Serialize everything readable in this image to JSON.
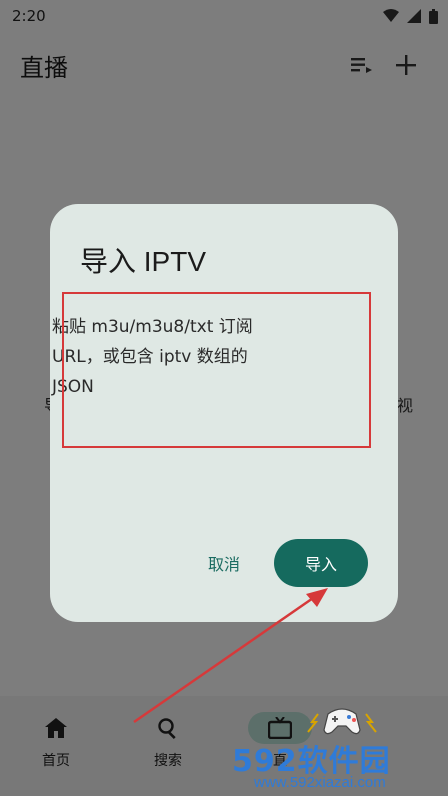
{
  "status": {
    "time": "2:20"
  },
  "appbar": {
    "title": "直播",
    "playlist_icon": "playlist-icon",
    "add_icon": "add-icon"
  },
  "page_hint": {
    "left": "导",
    "right": "视"
  },
  "dialog": {
    "title": "导入 IPTV",
    "field_placeholder": "粘贴 m3u/m3u8/txt 订阅\nURL，或包含 iptv 数组的\nJSON",
    "cancel_label": "取消",
    "import_label": "导入"
  },
  "bottom_nav": [
    {
      "label": "首页",
      "icon": "home-icon"
    },
    {
      "label": "搜索",
      "icon": "search-icon"
    },
    {
      "label": "直",
      "icon": "tv-icon",
      "active": true
    },
    {
      "label": "",
      "icon": "game-icon"
    }
  ],
  "watermark": {
    "main": "592软件园",
    "sub": "www.592xiazai.com"
  },
  "colors": {
    "accent": "#156a5e",
    "annotation": "#d6393a",
    "watermark": "#2f7bd8"
  }
}
